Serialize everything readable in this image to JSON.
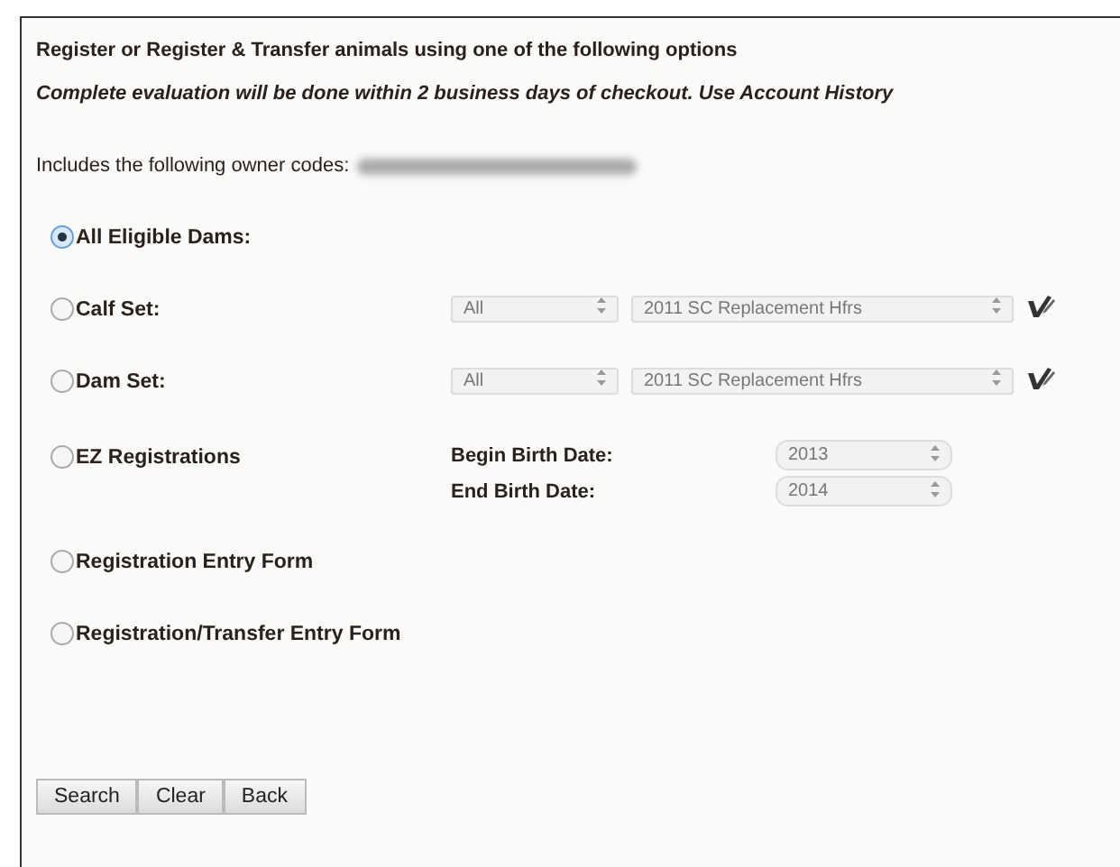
{
  "intro": "Register or Register & Transfer animals using one of the following options",
  "note": "Complete evaluation will be done within 2 business days of checkout. Use Account History",
  "owner_codes": {
    "label": "Includes the following owner codes:"
  },
  "options": [
    {
      "kind": "plain",
      "label": "All Eligible Dams:",
      "selected": true
    },
    {
      "kind": "sets",
      "label": "Calf Set:",
      "selected": false,
      "filter": "All",
      "set": "2011 SC Replacement Hfrs"
    },
    {
      "kind": "sets",
      "label": "Dam Set:",
      "selected": false,
      "filter": "All",
      "set": "2011 SC Replacement Hfrs"
    },
    {
      "kind": "dates",
      "label": "EZ Registrations",
      "selected": false,
      "dates": [
        {
          "label": "Begin Birth Date:",
          "value": "2013"
        },
        {
          "label": "End Birth Date:",
          "value": "2014"
        }
      ]
    },
    {
      "kind": "plain",
      "label": "Registration Entry Form",
      "selected": false
    },
    {
      "kind": "plain",
      "label": "Registration/Transfer Entry Form",
      "selected": false
    }
  ],
  "buttons": [
    "Search",
    "Clear",
    "Back"
  ]
}
